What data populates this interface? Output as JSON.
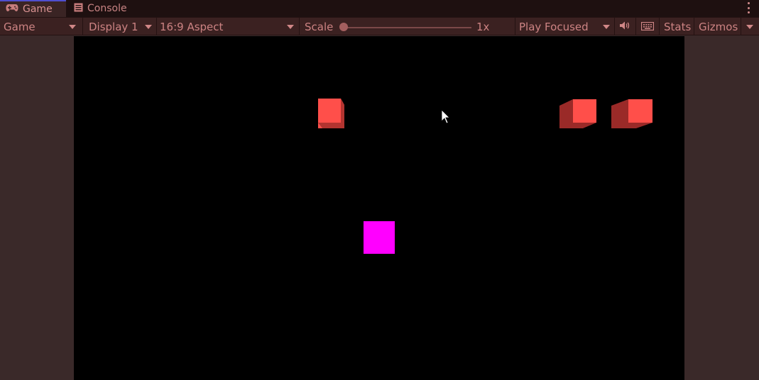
{
  "tabs": [
    {
      "label": "Game",
      "icon": "gamepad-icon",
      "active": true
    },
    {
      "label": "Console",
      "icon": "console-icon",
      "active": false
    }
  ],
  "toolbar": {
    "view_select": "Game",
    "display_select": "Display 1",
    "aspect_select": "16:9 Aspect",
    "scale_label": "Scale",
    "scale_value": "1x",
    "scale_level": 0.0,
    "play_mode_select": "Play Focused",
    "audio_icon": "speaker-icon",
    "keyboard_icon": "keyboard-icon",
    "stats_label": "Stats",
    "gizmos_label": "Gizmos"
  },
  "colors": {
    "panel_bg": "#3b2121",
    "tabbar_bg": "#1e1010",
    "text": "#cc8383",
    "game_bg": "#000000",
    "cube_red": "#ff4f4a",
    "cube_magenta": "#ff00ff"
  },
  "scene": {
    "objects": [
      "red-cube",
      "red-cube",
      "red-cube",
      "magenta-square"
    ]
  }
}
